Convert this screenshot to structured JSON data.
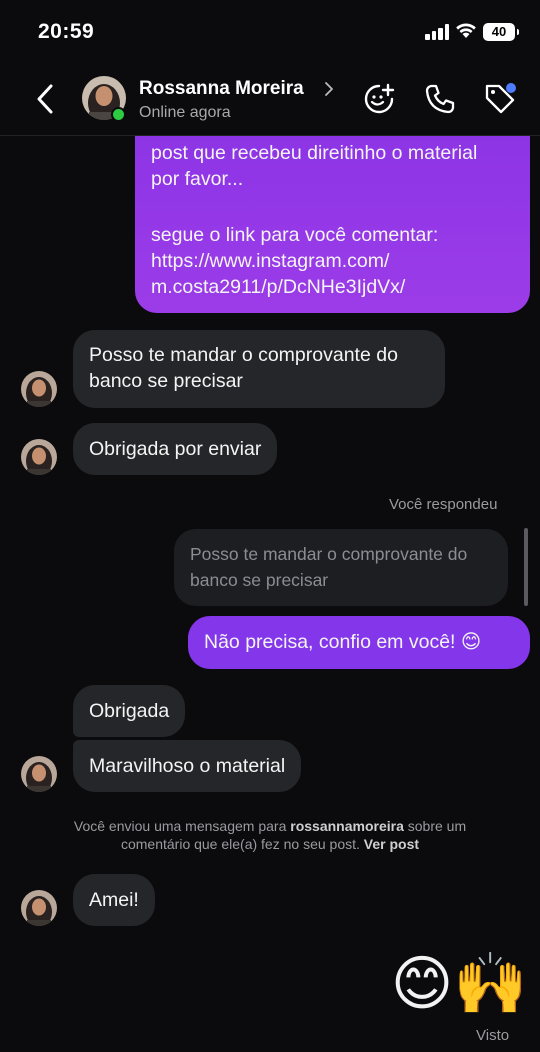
{
  "status_bar": {
    "time": "20:59",
    "battery": "40"
  },
  "header": {
    "contact_name": "Rossanna Moreira",
    "status": "Online agora",
    "icons": [
      "back-icon",
      "sticker-add-icon",
      "phone-icon",
      "tag-icon"
    ]
  },
  "messages": {
    "m1_out": "post que recebeu direitinho o material por favor...\n\nsegue o link para você comentar:\nhttps://www.instagram.com/\nm.costa2911/p/DcNHe3IjdVx/",
    "m1_line1": "post que recebeu direitinho o material",
    "m1_line2": "por favor...",
    "m1_line3": "segue o link para você comentar:",
    "m1_line4": "https://www.instagram.com/",
    "m1_line5": "m.costa2911/p/DcNHe3IjdVx/",
    "m2_in": "Posso te mandar o comprovante do banco se precisar",
    "m3_in": "Obrigada por enviar",
    "reply_label": "Você respondeu",
    "quoted": "Posso te mandar o comprovante do banco se precisar",
    "m4_out": "Não precisa, confio em você! 😊",
    "m5_in": "Obrigada",
    "m6_in": "Maravilhoso o material",
    "note_prefix": "Você enviou uma mensagem para ",
    "note_user": "rossannamoreira",
    "note_mid": " sobre um comentário que ele(a) fez no seu post. ",
    "note_link": "Ver post",
    "m7_in": "Amei!",
    "m8_out_emoji": "😊🙌",
    "seen": "Visto"
  },
  "colors": {
    "background": "#0b0b0d",
    "incoming_bubble": "#25262a",
    "outgoing_bubble": "#8a33e6",
    "online": "#2ecc40",
    "tag_badge": "#4f7bff"
  }
}
